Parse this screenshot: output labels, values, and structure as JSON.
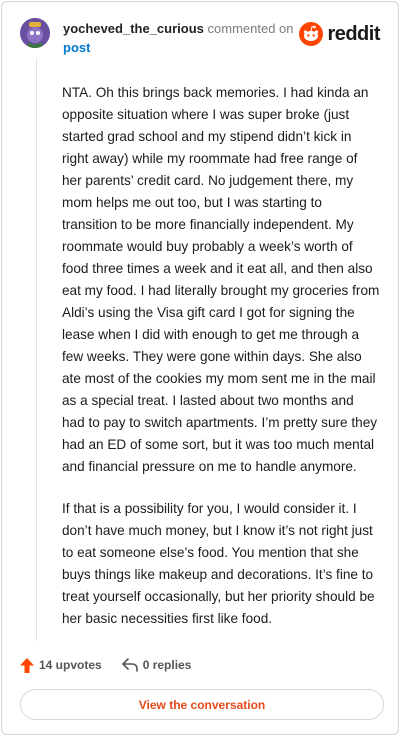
{
  "comment": {
    "username": "yocheved_the_curious",
    "commented_on": "commented on",
    "post_link": "post",
    "paragraphs": [
      "NTA. Oh this brings back memories. I had kinda an opposite situation where I was super broke (just started grad school and my stipend didn’t kick in right away) while my roommate had free range of her parents’ credit card. No judgement there, my mom helps me out too, but I was starting to transition to be more financially independent. My roommate would buy probably a week’s worth of food three times a week and it eat all, and then also eat my food. I had literally brought my groceries from Aldi’s using the Visa gift card I got for signing the lease when I did with enough to get me through a few weeks. They were gone within days. She also ate most of the cookies my mom sent me in the mail as a special treat. I lasted about two months and had to pay to switch apartments. I’m pretty sure they had an ED of some sort, but it was too much mental and financial pressure on me to handle anymore.",
      "If that is a possibility for you, I would consider it. I don’t have much money, but I know it’s not right just to eat someone else’s food. You mention that she buys things like makeup and decorations. It’s fine to treat yourself occasionally, but her priority should be her basic necessities first like food."
    ],
    "upvotes": "14 upvotes",
    "replies": "0 replies"
  },
  "brand": {
    "wordmark": "reddit"
  },
  "footer": {
    "view_conversation": "View the conversation"
  },
  "colors": {
    "accent": "#ff4500",
    "link": "#0079d3",
    "button_text": "#e34a1c"
  },
  "icons": {
    "upvote": "upvote-arrow-icon",
    "reply": "reply-arrow-icon",
    "logo": "reddit-snoo-icon"
  }
}
